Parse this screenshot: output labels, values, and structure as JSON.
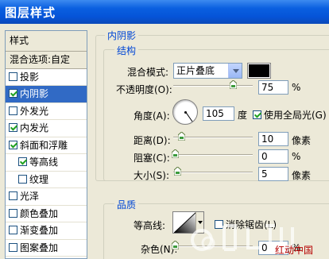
{
  "window": {
    "title": "图层样式"
  },
  "sidebar": {
    "header": "样式",
    "blend_options": "混合选项:自定",
    "items": [
      {
        "label": "投影",
        "checked": false,
        "selected": false,
        "indent": false
      },
      {
        "label": "内阴影",
        "checked": true,
        "selected": true,
        "indent": false
      },
      {
        "label": "外发光",
        "checked": false,
        "selected": false,
        "indent": false
      },
      {
        "label": "内发光",
        "checked": true,
        "selected": false,
        "indent": false
      },
      {
        "label": "斜面和浮雕",
        "checked": true,
        "selected": false,
        "indent": false
      },
      {
        "label": "等高线",
        "checked": true,
        "selected": false,
        "indent": true
      },
      {
        "label": "纹理",
        "checked": false,
        "selected": false,
        "indent": true
      },
      {
        "label": "光泽",
        "checked": false,
        "selected": false,
        "indent": false
      },
      {
        "label": "颜色叠加",
        "checked": false,
        "selected": false,
        "indent": false
      },
      {
        "label": "渐变叠加",
        "checked": false,
        "selected": false,
        "indent": false
      },
      {
        "label": "图案叠加",
        "checked": false,
        "selected": false,
        "indent": false
      }
    ]
  },
  "panel": {
    "title": "内阴影",
    "structure": {
      "title": "结构",
      "blend_mode_label": "混合模式:",
      "blend_mode_value": "正片叠底",
      "shadow_color": "#000000",
      "opacity_label": "不透明度(O):",
      "opacity_value": "75",
      "opacity_unit": "%",
      "opacity_level": 0.75,
      "angle_label": "角度(A):",
      "angle_value": "105",
      "angle_unit": "度",
      "global_light_label": "使用全局光(G)",
      "global_light_checked": true,
      "distance_label": "距离(D):",
      "distance_value": "10",
      "distance_unit": "像素",
      "choke_label": "阻塞(C):",
      "choke_value": "0",
      "choke_unit": "%",
      "size_label": "大小(S):",
      "size_value": "5",
      "size_unit": "像素"
    },
    "quality": {
      "title": "品质",
      "contour_label": "等高线:",
      "anti_alias_label": "消除锯齿(L)",
      "anti_alias_checked": false,
      "noise_label": "杂色(N):",
      "noise_value": "0",
      "noise_unit": "%"
    }
  },
  "watermark": {
    "text": "红动中国"
  }
}
